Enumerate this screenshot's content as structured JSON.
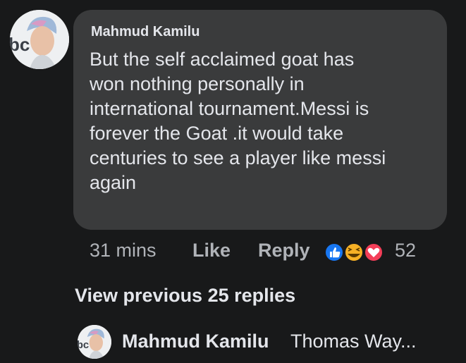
{
  "comment": {
    "author": "Mahmud Kamilu",
    "text": "But the self acclaimed goat has\nwon nothing personally in\ninternational tournament.Messi is\nforever the Goat .it would take\ncenturies to see a player like messi\nagain",
    "time": "31 mins",
    "like_label": "Like",
    "reply_label": "Reply",
    "reaction_count": "52",
    "reaction_icons": [
      "like-reaction",
      "haha-reaction",
      "love-reaction"
    ]
  },
  "view_previous_label": "View previous 25 replies",
  "reply_preview": {
    "author": "Mahmud Kamilu",
    "text": "Thomas Way..."
  },
  "colors": {
    "background": "#18191a",
    "bubble": "#3a3b3c",
    "primary_text": "#e4e6eb",
    "secondary_text": "#b0b3b8",
    "like_blue": "#1877f2",
    "haha_yellow": "#f7b125",
    "love_red": "#f33e58"
  }
}
